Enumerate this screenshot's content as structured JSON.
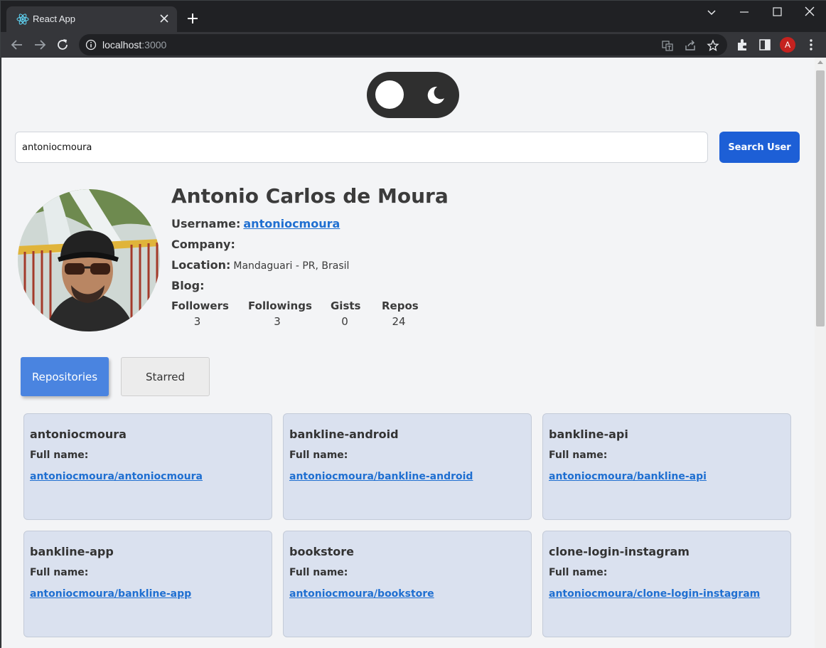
{
  "browser": {
    "tab_title": "React App",
    "url_host": "localhost",
    "url_port": ":3000",
    "profile_initial": "A"
  },
  "theme": {
    "accent": "#1d5fd6",
    "tab_active": "#4a84e0",
    "card_bg": "#dae1ef",
    "link": "#1f6fd1"
  },
  "search": {
    "value": "antoniocmoura",
    "button_label": "Search User"
  },
  "profile": {
    "name": "Antonio Carlos de Moura",
    "username_label": "Username:",
    "username": "antoniocmoura",
    "company_label": "Company:",
    "company": "",
    "location_label": "Location:",
    "location": "Mandaguari - PR, Brasil",
    "blog_label": "Blog:",
    "blog": "",
    "stats": [
      {
        "label": "Followers",
        "value": "3"
      },
      {
        "label": "Followings",
        "value": "3"
      },
      {
        "label": "Gists",
        "value": "0"
      },
      {
        "label": "Repos",
        "value": "24"
      }
    ]
  },
  "tabs": [
    {
      "label": "Repositories",
      "active": true
    },
    {
      "label": "Starred",
      "active": false
    }
  ],
  "repos": [
    {
      "name": "antoniocmoura",
      "full_name_label": "Full name:",
      "full_name": "antoniocmoura/antoniocmoura"
    },
    {
      "name": "bankline-android",
      "full_name_label": "Full name:",
      "full_name": "antoniocmoura/bankline-android"
    },
    {
      "name": "bankline-api",
      "full_name_label": "Full name:",
      "full_name": "antoniocmoura/bankline-api"
    },
    {
      "name": "bankline-app",
      "full_name_label": "Full name:",
      "full_name": "antoniocmoura/bankline-app"
    },
    {
      "name": "bookstore",
      "full_name_label": "Full name:",
      "full_name": "antoniocmoura/bookstore"
    },
    {
      "name": "clone-login-instagram",
      "full_name_label": "Full name:",
      "full_name": "antoniocmoura/clone-login-instagram"
    }
  ]
}
